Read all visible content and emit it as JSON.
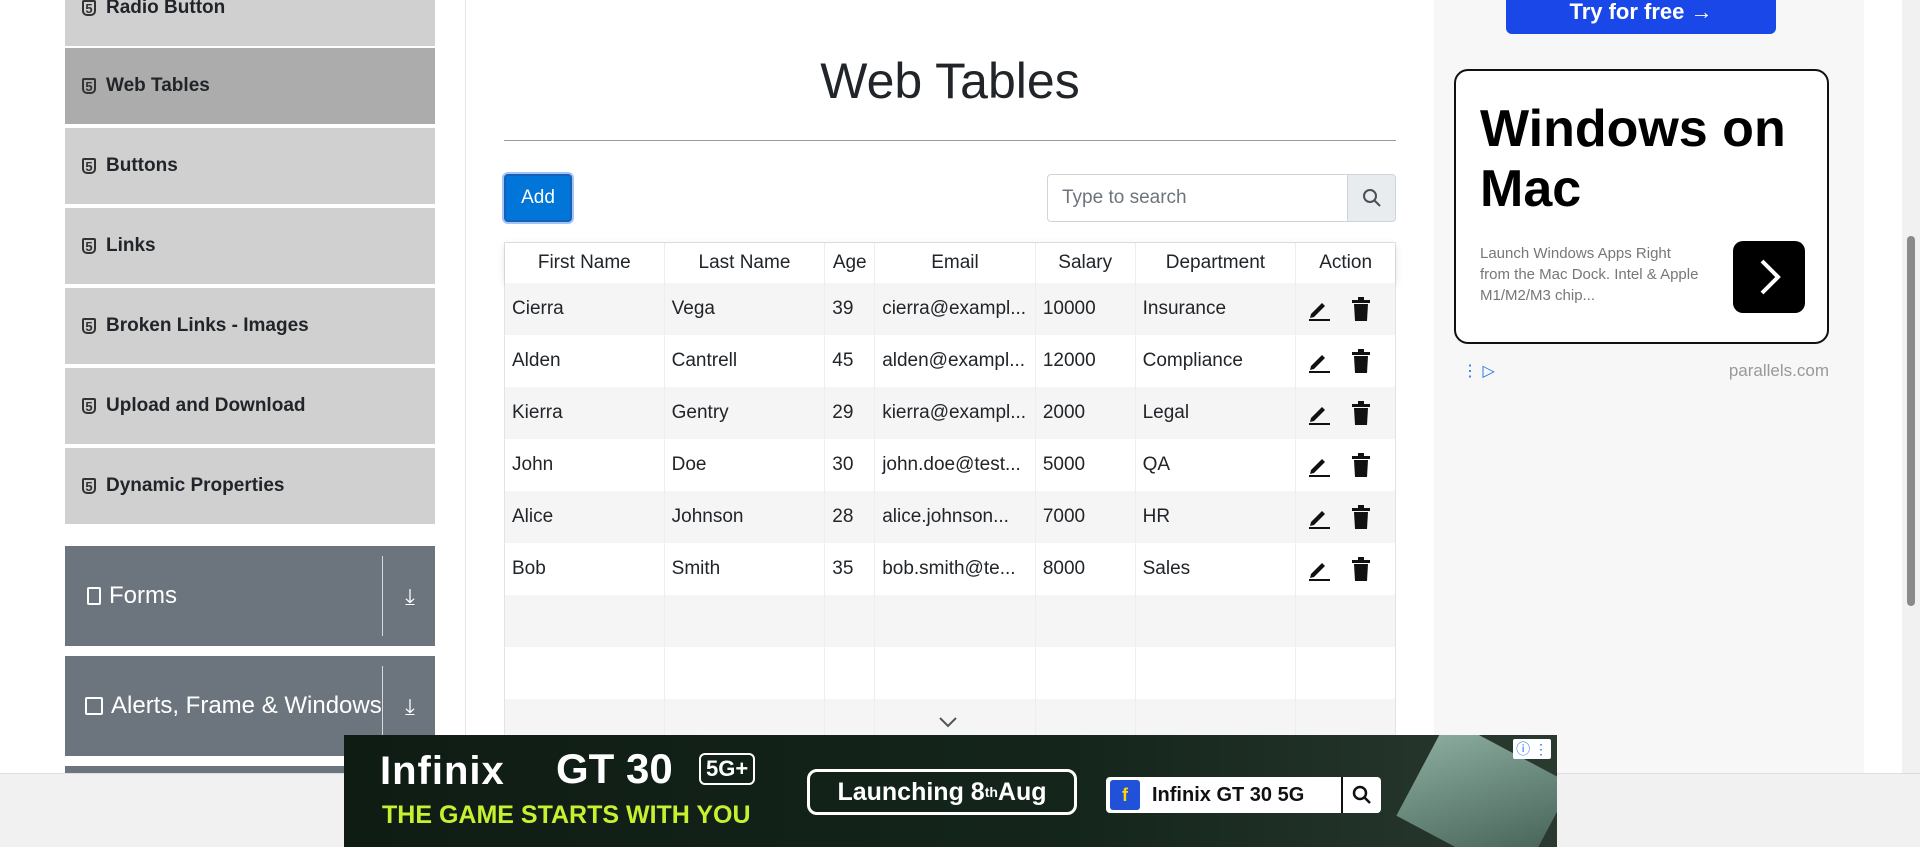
{
  "sidebar": {
    "items": [
      {
        "label": "Radio Button",
        "active": false
      },
      {
        "label": "Web Tables",
        "active": true
      },
      {
        "label": "Buttons",
        "active": false
      },
      {
        "label": "Links",
        "active": false
      },
      {
        "label": "Broken Links - Images",
        "active": false
      },
      {
        "label": "Upload and Download",
        "active": false
      },
      {
        "label": "Dynamic Properties",
        "active": false
      }
    ],
    "groups": [
      {
        "label": "Forms"
      },
      {
        "label": "Alerts, Frame & Windows"
      }
    ]
  },
  "main": {
    "title": "Web Tables",
    "add_label": "Add",
    "search_placeholder": "Type to search",
    "table": {
      "headers": [
        "First Name",
        "Last Name",
        "Age",
        "Email",
        "Salary",
        "Department",
        "Action"
      ],
      "rows": [
        [
          "Cierra",
          "Vega",
          "39",
          "cierra@exampl...",
          "10000",
          "Insurance"
        ],
        [
          "Alden",
          "Cantrell",
          "45",
          "alden@exampl...",
          "12000",
          "Compliance"
        ],
        [
          "Kierra",
          "Gentry",
          "29",
          "kierra@exampl...",
          "2000",
          "Legal"
        ],
        [
          "John",
          "Doe",
          "30",
          "john.doe@test...",
          "5000",
          "QA"
        ],
        [
          "Alice",
          "Johnson",
          "28",
          "alice.johnson...",
          "7000",
          "HR"
        ],
        [
          "Bob",
          "Smith",
          "35",
          "bob.smith@te...",
          "8000",
          "Sales"
        ]
      ],
      "empty_rows": 3
    }
  },
  "right_ad": {
    "cta": "Try for free  →",
    "headline": "Windows on Mac",
    "subtext": "Launch Windows Apps Right from the Mac Dock. Intel & Apple M1/M2/M3 chip...",
    "domain": "parallels.com"
  },
  "bottom_ad": {
    "brand": "Infinix",
    "model": "GT 30",
    "badge": "5G+",
    "tagline": "THE GAME STARTS WITH YOU",
    "launch_text": "Launching 8",
    "launch_sup": "th",
    "launch_month": " Aug",
    "search_text": "Infinix GT 30 5G"
  },
  "colors": {
    "primary": "#0275d8",
    "sidebar_item": "#d0d0d0",
    "sidebar_active": "#acacac",
    "group_bg": "#6c757d"
  }
}
